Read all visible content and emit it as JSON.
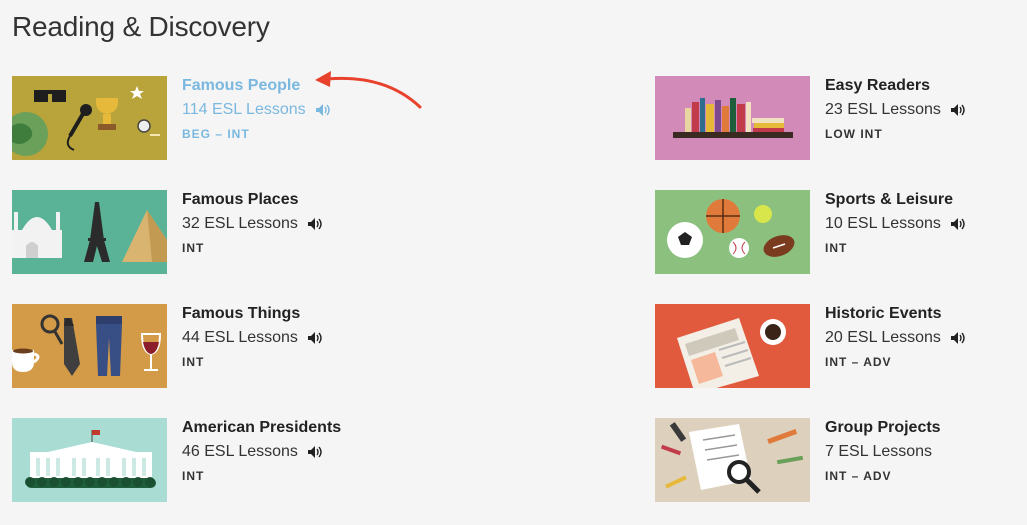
{
  "page": {
    "title": "Reading & Discovery"
  },
  "categories": [
    {
      "title": "Famous People",
      "lessons": "114 ESL Lessons",
      "level": "BEG – INT",
      "active": true
    },
    {
      "title": "Famous Places",
      "lessons": "32 ESL Lessons",
      "level": "INT"
    },
    {
      "title": "Famous Things",
      "lessons": "44 ESL Lessons",
      "level": "INT"
    },
    {
      "title": "American Presidents",
      "lessons": "46 ESL Lessons",
      "level": "INT"
    },
    {
      "title": "Easy Readers",
      "lessons": "23 ESL Lessons",
      "level": "LOW INT"
    },
    {
      "title": "Sports & Leisure",
      "lessons": "10 ESL Lessons",
      "level": "INT"
    },
    {
      "title": "Historic Events",
      "lessons": "20 ESL Lessons",
      "level": "INT – ADV"
    },
    {
      "title": "Group Projects",
      "lessons": "7 ESL Lessons",
      "level": "INT – ADV"
    }
  ],
  "colors": {
    "active_link": "#7ab8e0",
    "arrow": "#e8412c",
    "thumb_famous_people": "#b9a33b",
    "thumb_famous_places": "#5ab397",
    "thumb_famous_things": "#d39a47",
    "thumb_american_presidents": "#a9ddd4",
    "thumb_easy_readers": "#d28ab9",
    "thumb_sports_leisure": "#8cc07f",
    "thumb_historic_events": "#e15a3e",
    "thumb_group_projects": "#ddd0bd"
  },
  "icons": {
    "speaker": "speaker-icon",
    "annotation": "red-arrow-annotation"
  }
}
